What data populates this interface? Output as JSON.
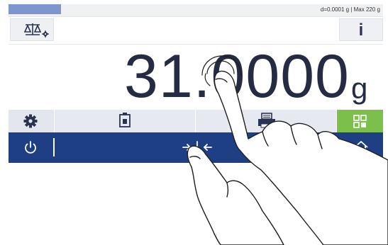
{
  "status": {
    "readability": "d=0.0001 g",
    "separator": "|",
    "capacity": "Max 220 g"
  },
  "toolbar": {
    "balance_settings_icon": "balance-settings-icon",
    "info_label": "i"
  },
  "weight": {
    "value": "31.0000",
    "unit": "g"
  },
  "functions": {
    "settings_icon": "gear-icon",
    "weighing_icon": "weight-icon",
    "print_icon": "printer-icon",
    "apps_icon": "apps-grid-icon"
  },
  "navigation": {
    "power_icon": "power-icon",
    "zero_icon": "zero-icon",
    "home_icon": "home-icon"
  },
  "colors": {
    "accent_blue": "#1f3f85",
    "status_blue": "#7f95cf",
    "apps_green": "#7cc04b",
    "text_dark": "#252b43"
  }
}
